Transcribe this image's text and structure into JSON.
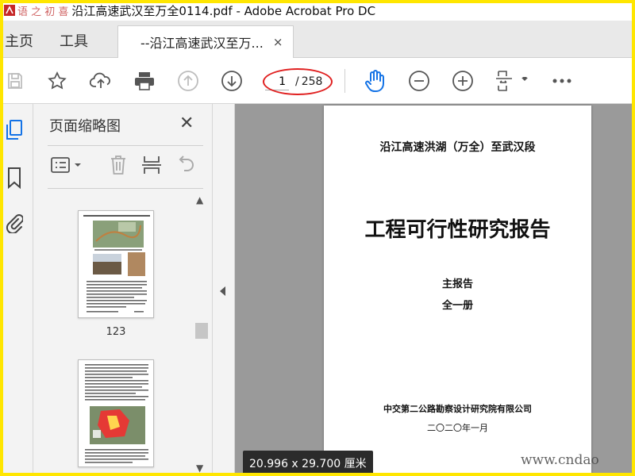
{
  "window": {
    "watermark_prefix": "语 之 初 喜",
    "title": "沿江高速武汉至万全0114.pdf - Adobe Acrobat Pro DC"
  },
  "tabs": {
    "home": "主页",
    "tools": "工具",
    "document": "--沿江高速武汉至万...",
    "close_symbol": "×"
  },
  "toolbar": {
    "icons": [
      "save-icon",
      "bookmark-star-icon",
      "cloud-upload-icon",
      "print-icon",
      "page-up-icon",
      "page-down-icon",
      "hand-tool-icon",
      "zoom-out-icon",
      "zoom-in-icon",
      "fit-page-icon",
      "more-icon"
    ],
    "current_page": "1",
    "page_separator": "/",
    "total_pages": "258",
    "accent": "#1473e6",
    "highlight": "#e02020"
  },
  "thumbnails": {
    "panel_title": "页面缩略图",
    "close_symbol": "✕",
    "pages": [
      {
        "label": "123"
      },
      {
        "label": ""
      }
    ]
  },
  "document": {
    "subtitle": "沿江高速洪湖（万全）至武汉段",
    "title": "工程可行性研究报告",
    "section": "主报告",
    "volume": "全一册",
    "publisher": "中交第二公路勘察设计研究院有限公司",
    "date": "二〇二〇年一月"
  },
  "status": {
    "dimensions": "20.996 x 29.700 厘米"
  },
  "watermark": {
    "site": "www.cndao"
  }
}
